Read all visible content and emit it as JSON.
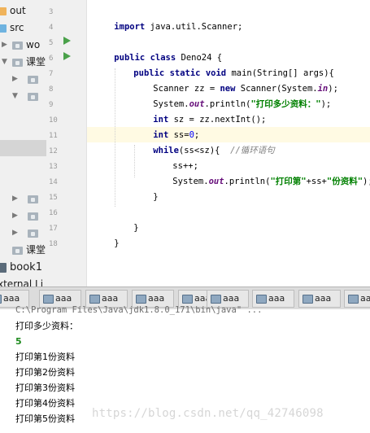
{
  "project_tree": [
    {
      "label": "out",
      "icon": "folder-orange"
    },
    {
      "label": "src",
      "icon": "folder-blue"
    },
    {
      "label": "wo",
      "icon": "folder-grey"
    },
    {
      "label": "课堂",
      "icon": "folder-grey"
    },
    {
      "label": "",
      "icon": "folder-grey"
    },
    {
      "label": "",
      "icon": "folder-grey"
    },
    {
      "label": "",
      "icon": "folder-grey"
    },
    {
      "label": "",
      "icon": "folder-grey"
    },
    {
      "label": "",
      "icon": "folder-grey"
    },
    {
      "label": "课堂",
      "icon": "folder-grey"
    },
    {
      "label": "book1",
      "icon": "book"
    },
    {
      "label": "xternal Li",
      "icon": "none"
    }
  ],
  "line_numbers": [
    "3",
    "4",
    "5",
    "6",
    "7",
    "8",
    "9",
    "10",
    "11",
    "12",
    "13",
    "14",
    "15",
    "16",
    "17",
    "18"
  ],
  "code_lines": {
    "l3": {
      "kw": "import",
      "rest": " java.util.Scanner;"
    },
    "l5": {
      "kw1": "public",
      "kw2": "class",
      "rest": " Deno24 {"
    },
    "l6": {
      "kw1": "public",
      "kw2": "static",
      "kw3": "void",
      "rest": " main(String[] args){"
    },
    "l7": {
      "pre": "Scanner zz = ",
      "kw": "new",
      "mid": " Scanner(System.",
      "fld": "in",
      "post": ");"
    },
    "l8": {
      "pre": "System.",
      "fld": "out",
      "mid": ".println(",
      "str": "\"打印多少资料：\"",
      "post": ");"
    },
    "l9": {
      "kw": "int",
      "rest": " sz = zz.nextInt();"
    },
    "l10": {
      "kw": "int",
      "rest": " ss=",
      "num": "0",
      "post": ";"
    },
    "l11": {
      "kw": "while",
      "rest": "(ss<sz){  ",
      "cmt": "//循环语句"
    },
    "l12": {
      "rest": "ss++;"
    },
    "l13": {
      "pre": "System.",
      "fld": "out",
      "mid": ".println(",
      "str1": "\"打印第\"",
      "op1": "+ss+",
      "str2": "\"份资料\"",
      "post": ");"
    },
    "l14": {
      "rest": "}"
    },
    "l16": {
      "rest": "}"
    },
    "l17": {
      "rest": "}"
    }
  },
  "tabs": [
    "aaa",
    "aaa",
    "aaa",
    "aaa",
    "aaa",
    "aaa",
    "aaa",
    "aaa",
    "aaa"
  ],
  "console": {
    "command": "C:\\Program Files\\Java\\jdk1.8.0_171\\bin\\java\" ...",
    "prompt": "打印多少资料：",
    "input": "5",
    "outputs": [
      "打印第1份资料",
      "打印第2份资料",
      "打印第3份资料",
      "打印第4份资料",
      "打印第5份资料"
    ]
  },
  "watermark": "https://blog.csdn.net/qq_42746098",
  "colors": {
    "keyword": "#000080",
    "string": "#008000",
    "field": "#660e7a",
    "number": "#0000ff",
    "comment": "#808080",
    "input": "#1d8a1d"
  }
}
